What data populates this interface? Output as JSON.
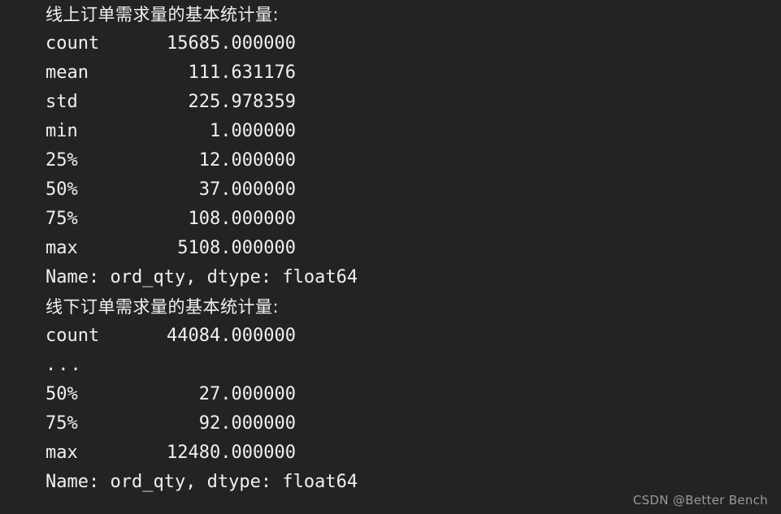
{
  "console": {
    "background_color": "#232323",
    "text_color": "#f0f0f0",
    "blocks": [
      {
        "heading": "线上订单需求量的基本统计量:",
        "rows": [
          {
            "label": "count",
            "value": "15685.000000"
          },
          {
            "label": "mean",
            "value": "111.631176"
          },
          {
            "label": "std",
            "value": "225.978359"
          },
          {
            "label": "min",
            "value": "1.000000"
          },
          {
            "label": "25%",
            "value": "12.000000"
          },
          {
            "label": "50%",
            "value": "37.000000"
          },
          {
            "label": "75%",
            "value": "108.000000"
          },
          {
            "label": "max",
            "value": "5108.000000"
          }
        ],
        "footer": "Name: ord_qty, dtype: float64"
      },
      {
        "heading": "线下订单需求量的基本统计量:",
        "rows": [
          {
            "label": "count",
            "value": "44084.000000"
          },
          {
            "label": "...",
            "value": ""
          },
          {
            "label": "50%",
            "value": "27.000000"
          },
          {
            "label": "75%",
            "value": "92.000000"
          },
          {
            "label": "max",
            "value": "12480.000000"
          }
        ],
        "footer": "Name: ord_qty, dtype: float64"
      }
    ]
  },
  "watermark": {
    "text": "CSDN @Better Bench",
    "color": "#9a9a9a"
  },
  "lines": {
    "b0_heading": "线上订单需求量的基本统计量:",
    "b0_r0_label": "count",
    "b0_r0_value": "15685.000000",
    "b0_r1_label": "mean",
    "b0_r1_value": "111.631176",
    "b0_r2_label": "std",
    "b0_r2_value": "225.978359",
    "b0_r3_label": "min",
    "b0_r3_value": "1.000000",
    "b0_r4_label": "25%",
    "b0_r4_value": "12.000000",
    "b0_r5_label": "50%",
    "b0_r5_value": "37.000000",
    "b0_r6_label": "75%",
    "b0_r6_value": "108.000000",
    "b0_r7_label": "max",
    "b0_r7_value": "5108.000000",
    "b0_footer": "Name: ord_qty, dtype: float64",
    "b1_heading": "线下订单需求量的基本统计量:",
    "b1_r0_label": "count",
    "b1_r0_value": "44084.000000",
    "b1_r1_label": "...",
    "b1_r1_value": "",
    "b1_r2_label": "50%",
    "b1_r2_value": "27.000000",
    "b1_r3_label": "75%",
    "b1_r3_value": "92.000000",
    "b1_r4_label": "max",
    "b1_r4_value": "12480.000000",
    "b1_footer": "Name: ord_qty, dtype: float64"
  }
}
